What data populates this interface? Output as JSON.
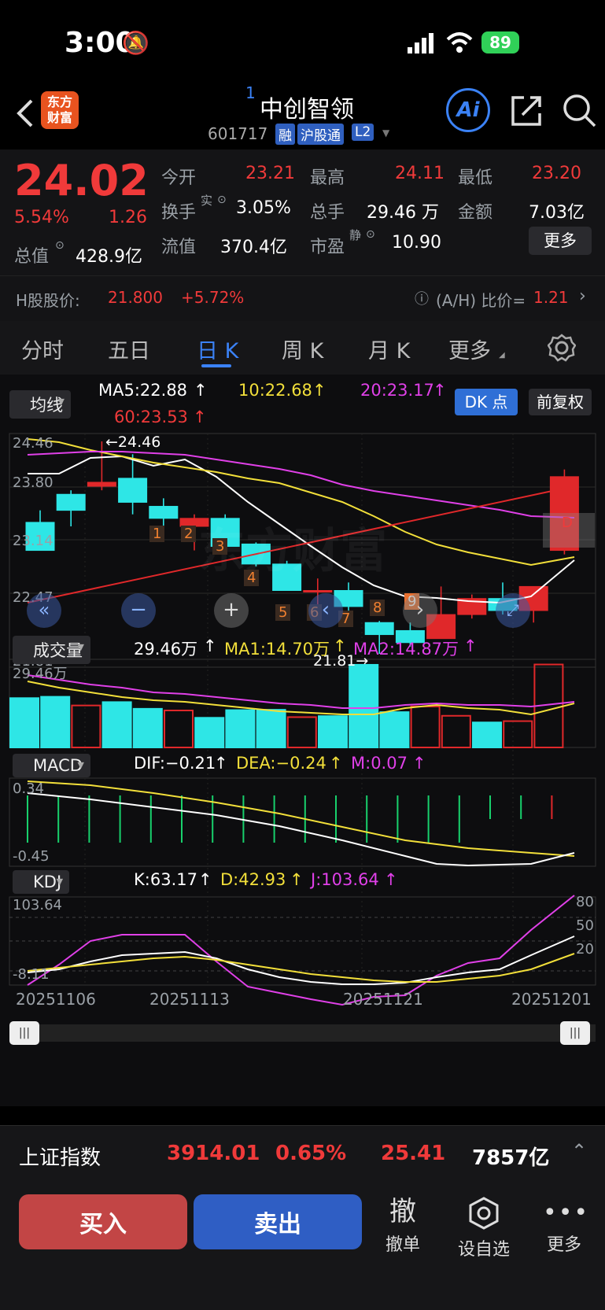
{
  "status_bar": {
    "time": "3:00",
    "battery": "89"
  },
  "header": {
    "superscript": "1",
    "stock_name": "中创智领",
    "code": "601717",
    "tags": [
      "融",
      "沪股通",
      "L2"
    ],
    "logo_line1": "东方",
    "logo_line2": "财富",
    "ai_label": "Ai"
  },
  "quote": {
    "price": "24.02",
    "pct": "5.54%",
    "change": "1.26",
    "open_label": "今开",
    "open": "23.21",
    "high_label": "最高",
    "high": "24.11",
    "low_label": "最低",
    "low": "23.20",
    "turnover_label": "换手",
    "turnover_sup": "实",
    "turnover": "3.05%",
    "volume_label": "总手",
    "volume": "29.46 万",
    "amount_label": "金额",
    "amount": "7.03亿",
    "mktcap_label": "总值",
    "mktcap": "428.9亿",
    "float_label": "流值",
    "float": "370.4亿",
    "pe_label": "市盈",
    "pe_sup": "静",
    "pe": "10.90",
    "more": "更多"
  },
  "hshare": {
    "label": "H股股价:",
    "price": "21.800",
    "pct": "+5.72%",
    "ratio_label": "(A/H) 比价=",
    "ratio": "1.21"
  },
  "tabs": [
    "分时",
    "五日",
    "日 K",
    "周 K",
    "月 K",
    "更多"
  ],
  "ma_bar": {
    "selector": "均线",
    "ma5": "MA5:22.88",
    "ma10": "10:22.68",
    "ma20": "20:23.17",
    "ma60": "60:23.53",
    "dk_button": "DK 点",
    "fq_button": "前复权"
  },
  "kline_axis": {
    "y1": "24.46",
    "y2": "23.80",
    "y3": "23.14",
    "y4": "22.47",
    "y5": "21.81",
    "high_mark": "←24.46",
    "low_mark": "21.81→",
    "dk_mark": "D",
    "watermark": "东方财富"
  },
  "td_labels": [
    "1",
    "2",
    "3",
    "4",
    "5",
    "6",
    "7",
    "8",
    "9"
  ],
  "volume_bar": {
    "selector": "成交量",
    "value": "29.46万",
    "ma1": "MA1:14.70万",
    "ma2": "MA2:14.87万",
    "axis_top": "29.46万"
  },
  "macd_bar": {
    "selector": "MACD",
    "dif": "DIF:−0.21",
    "dea": "DEA:−0.24",
    "m": "M:0.07",
    "axis_top": "0.34",
    "axis_bottom": "-0.45"
  },
  "kdj_bar": {
    "selector": "KDJ",
    "k": "K:63.17",
    "d": "D:42.93",
    "j": "J:103.64",
    "axis_top": "103.64",
    "axis_bottom": "-8.11",
    "r80": "80",
    "r50": "50",
    "r20": "20"
  },
  "dates": [
    "20251106",
    "20251113",
    "20251121",
    "20251201"
  ],
  "ticker": {
    "name": "上证指数",
    "price": "3914.01",
    "pct": "0.65%",
    "change": "25.41",
    "amount": "7857亿"
  },
  "actions": {
    "buy": "买入",
    "sell": "卖出",
    "cancel_icon": "撤",
    "cancel": "撤单",
    "watch": "设自选",
    "more": "更多"
  },
  "chart_data": {
    "type": "candlestick",
    "candles": [
      {
        "o": 23.45,
        "h": 23.6,
        "l": 23.1,
        "c": 23.1
      },
      {
        "o": 23.8,
        "h": 23.85,
        "l": 23.4,
        "c": 23.6
      },
      {
        "o": 23.9,
        "h": 24.46,
        "l": 23.85,
        "c": 23.95
      },
      {
        "o": 24.0,
        "h": 24.3,
        "l": 23.55,
        "c": 23.7
      },
      {
        "o": 23.65,
        "h": 23.75,
        "l": 23.35,
        "c": 23.5
      },
      {
        "o": 23.4,
        "h": 23.55,
        "l": 23.1,
        "c": 23.5
      },
      {
        "o": 23.5,
        "h": 23.55,
        "l": 23.1,
        "c": 23.15
      },
      {
        "o": 23.18,
        "h": 23.2,
        "l": 22.9,
        "c": 22.93
      },
      {
        "o": 22.93,
        "h": 22.97,
        "l": 22.6,
        "c": 22.6
      },
      {
        "o": 22.6,
        "h": 22.75,
        "l": 22.4,
        "c": 22.6
      },
      {
        "o": 22.6,
        "h": 22.7,
        "l": 22.3,
        "c": 22.4
      },
      {
        "o": 22.2,
        "h": 22.22,
        "l": 21.81,
        "c": 22.05
      },
      {
        "o": 22.1,
        "h": 22.2,
        "l": 21.9,
        "c": 21.95
      },
      {
        "o": 22.0,
        "h": 22.65,
        "l": 22.0,
        "c": 22.3
      },
      {
        "o": 22.3,
        "h": 22.55,
        "l": 22.25,
        "c": 22.5
      },
      {
        "o": 22.5,
        "h": 22.7,
        "l": 22.3,
        "c": 22.35
      },
      {
        "o": 22.35,
        "h": 22.55,
        "l": 22.2,
        "c": 22.65
      },
      {
        "o": 23.1,
        "h": 24.11,
        "l": 23.05,
        "c": 24.02
      }
    ],
    "volume": [
      14.8,
      15.2,
      12.6,
      13.6,
      11.6,
      11.1,
      8.9,
      11.2,
      11.3,
      9.1,
      9.4,
      24.8,
      10.6,
      12.3,
      9.5,
      7.5,
      7.9,
      24.9
    ]
  }
}
